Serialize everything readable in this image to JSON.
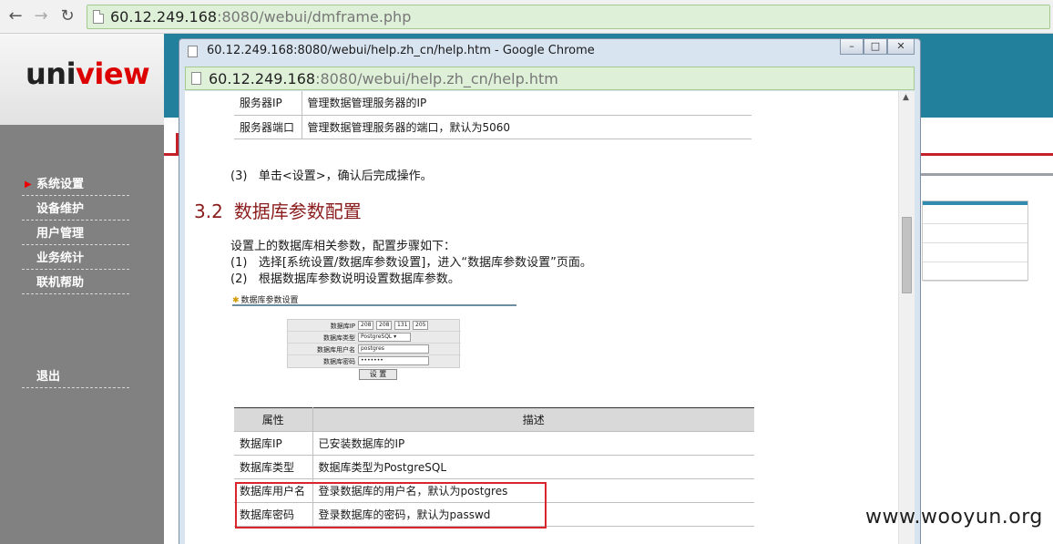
{
  "browser": {
    "url_host": "60.12.249.168",
    "url_rest": ":8080/webui/dmframe.php"
  },
  "logo": {
    "part1": "uni",
    "part2": "view"
  },
  "sidebar": {
    "items": [
      {
        "label": "系统设置"
      },
      {
        "label": "设备维护"
      },
      {
        "label": "用户管理"
      },
      {
        "label": "业务统计"
      },
      {
        "label": "联机帮助"
      },
      {
        "label": "退出"
      }
    ]
  },
  "popup": {
    "title": "60.12.249.168:8080/webui/help.zh_cn/help.htm - Google Chrome",
    "url_host": "60.12.249.168",
    "url_rest": ":8080/webui/help.zh_cn/help.htm",
    "buttons": {
      "minimize": "–",
      "maximize": "□",
      "close": "✕"
    }
  },
  "help": {
    "top_table": [
      {
        "attr": "服务器IP",
        "desc": "管理数据管理服务器的IP"
      },
      {
        "attr": "服务器端口",
        "desc": "管理数据管理服务器的端口，默认为5060"
      }
    ],
    "step3": {
      "num": "(3)",
      "text": "单击<设置>，确认后完成操作。"
    },
    "section": {
      "num": "3.2",
      "title": "数据库参数配置"
    },
    "intro": "设置上的数据库相关参数，配置步骤如下：",
    "steps": [
      {
        "num": "(1)",
        "text": "选择[系统设置/数据库参数设置]，进入“数据库参数设置”页面。"
      },
      {
        "num": "(2)",
        "text": "根据数据库参数说明设置数据库参数。"
      }
    ],
    "mini": {
      "title": "数据库参数设置",
      "ip_label": "数据库IP",
      "ip": [
        "208",
        "208",
        "131",
        "205"
      ],
      "type_label": "数据库类型",
      "type_value": "PostgreSQL ▾",
      "user_label": "数据库用户名",
      "user_value": "postgres",
      "pass_label": "数据库密码",
      "pass_value": "•••••••",
      "button": "设 置"
    },
    "params_table": {
      "headers": [
        "属性",
        "描述"
      ],
      "rows": [
        {
          "attr": "数据库IP",
          "desc": "已安装数据库的IP"
        },
        {
          "attr": "数据库类型",
          "desc": "数据库类型为PostgreSQL"
        },
        {
          "attr": "数据库用户名",
          "desc": "登录数据库的用户名，默认为postgres"
        },
        {
          "attr": "数据库密码",
          "desc": "登录数据库的密码，默认为passwd"
        }
      ]
    }
  },
  "watermark": "www.wooyun.org",
  "colors": {
    "accent_teal": "#23809c",
    "brand_red": "#d00000",
    "highlight": "#d9252b",
    "url_green": "#dff0d8"
  }
}
